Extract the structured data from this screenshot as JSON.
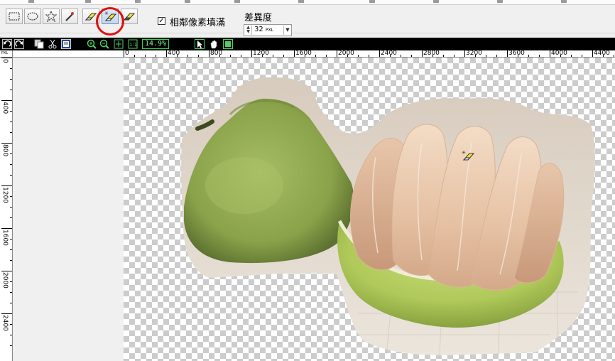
{
  "toolbar": {
    "tools": [
      {
        "name": "rect-select-tool",
        "icon": "rect-select-icon",
        "selected": false
      },
      {
        "name": "ellipse-select-tool",
        "icon": "ellipse-select-icon",
        "selected": false
      },
      {
        "name": "lasso-select-tool",
        "icon": "lasso-icon",
        "selected": false
      },
      {
        "name": "magic-wand-tool",
        "icon": "magic-wand-icon",
        "selected": false
      },
      {
        "name": "eraser-tool",
        "icon": "eraser-icon",
        "selected": false
      },
      {
        "name": "magic-eraser-tool",
        "icon": "magic-eraser-icon",
        "selected": true
      },
      {
        "name": "background-eraser-tool",
        "icon": "background-eraser-icon",
        "selected": false
      }
    ],
    "fill_option": {
      "label": "相鄰像素填滿",
      "checked": true,
      "check_glyph": "✓"
    },
    "tolerance": {
      "label": "差異度",
      "value": "32",
      "unit": "PXL"
    }
  },
  "view_toolbar": {
    "zoom_level": "14.9%",
    "buttons": [
      "undo-icon",
      "redo-icon",
      "copy-icon",
      "cut-icon",
      "paste-icon",
      "zoom-in-icon",
      "zoom-out-icon",
      "fit-to-window-icon",
      "actual-size-icon",
      "pointer-icon",
      "hand-icon",
      "select-area-icon"
    ]
  },
  "ruler": {
    "unit": "PXL",
    "horizontal_labels": [
      "0",
      "400",
      "800",
      "1200",
      "1600",
      "2000",
      "2400",
      "2800",
      "3200",
      "3600",
      "4000",
      "4400"
    ],
    "vertical_labels": [
      "0",
      "400",
      "800",
      "1200",
      "1600",
      "2000",
      "2400"
    ]
  },
  "colors": {
    "accent_ring": "#e01010",
    "view_toolbar_bg": "#000000",
    "zoom_text": "#7dff8c",
    "pomelo_peel": "#9cb55a",
    "pomelo_flesh": "#e9c4a6",
    "backdrop": "#e6ddd0"
  }
}
